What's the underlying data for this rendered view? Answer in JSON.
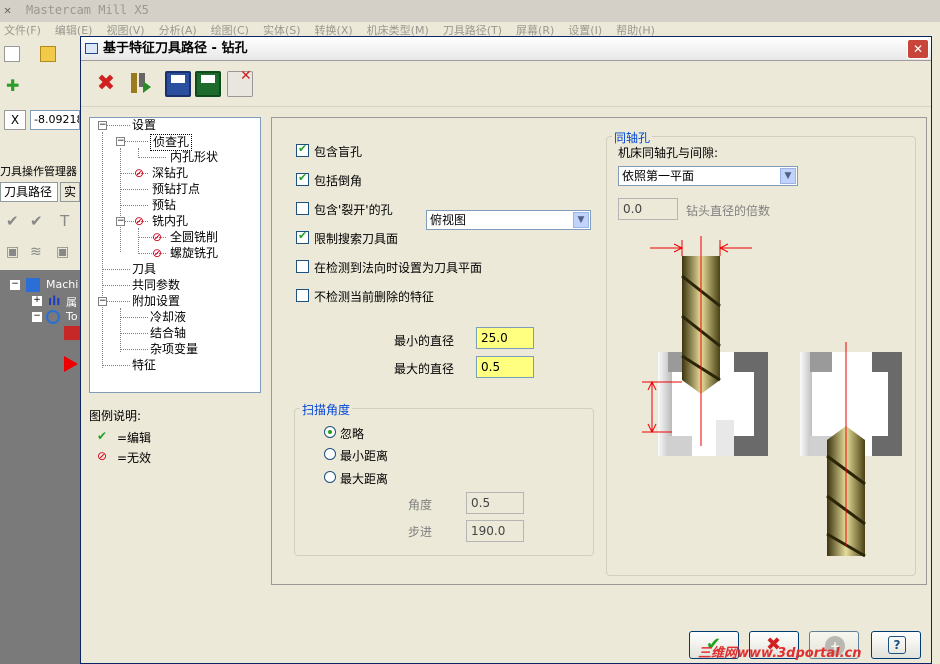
{
  "app": {
    "title": "Mastercam Mill X5",
    "menu": [
      "文件(F)",
      "编辑(E)",
      "视图(V)",
      "分析(A)",
      "绘图(C)",
      "实体(S)",
      "转换(X)",
      "机床类型(M)",
      "刀具路径(T)",
      "屏幕(R)",
      "设置(I)",
      "帮助(H)"
    ],
    "coord_value": "-8.09218",
    "manager_title": "刀具操作管理器",
    "manager_tabs": [
      "刀具路径",
      "实"
    ],
    "tree_items": [
      "Machi",
      "属",
      "To"
    ]
  },
  "dialog": {
    "title": "基于特征刀具路径 - 钻孔",
    "close_glyph": "✕"
  },
  "tree": {
    "root": "设置",
    "items": {
      "detect_holes": "侦查孔",
      "hole_shape": "内孔形状",
      "deep_drill": "深钻孔",
      "pre_drill_spot": "预钻打点",
      "pre_drill": "预钻",
      "mill_hole": "铣内孔",
      "full_circle": "全圆铣削",
      "helix": "螺旋铣孔",
      "tool": "刀具",
      "common": "共同参数",
      "extra": "附加设置",
      "coolant": "冷却液",
      "axis": "结合轴",
      "misc": "杂项变量",
      "feature": "特征"
    }
  },
  "legend": {
    "title": "图例说明:",
    "edit_label": "=编辑",
    "invalid_label": "=无效",
    "edit_icon": "✔",
    "invalid_icon": "⊘"
  },
  "options": {
    "include_blind": "包含盲孔",
    "include_chamfer": "包括倒角",
    "include_split": "包含'裂开'的孔",
    "split_view": "俯视图",
    "limit_search": "限制搜索刀具面",
    "set_plane": "在检测到法向时设置为刀具平面",
    "no_delete": "不检测当前删除的特征"
  },
  "diameters": {
    "min_label": "最小的直径",
    "min_value": "25.0",
    "max_label": "最大的直径",
    "max_value": "0.5"
  },
  "scan": {
    "title": "扫描角度",
    "ignore": "忽略",
    "min_dist": "最小距离",
    "max_dist": "最大距离",
    "angle_label": "角度",
    "angle_value": "0.5",
    "step_label": "步进",
    "step_value": "190.0"
  },
  "coaxial": {
    "title": "同轴孔",
    "label": "机床同轴孔与间隙:",
    "select_value": "依照第一平面",
    "multiple_value": "0.0",
    "multiple_label": "钻头直径的倍数"
  },
  "colors": {
    "accent": "#0046d5",
    "highlight": "#ffff80",
    "invalid": "#d0021b",
    "valid": "#21a121"
  },
  "watermark": "三维网www.3dportal.cn"
}
